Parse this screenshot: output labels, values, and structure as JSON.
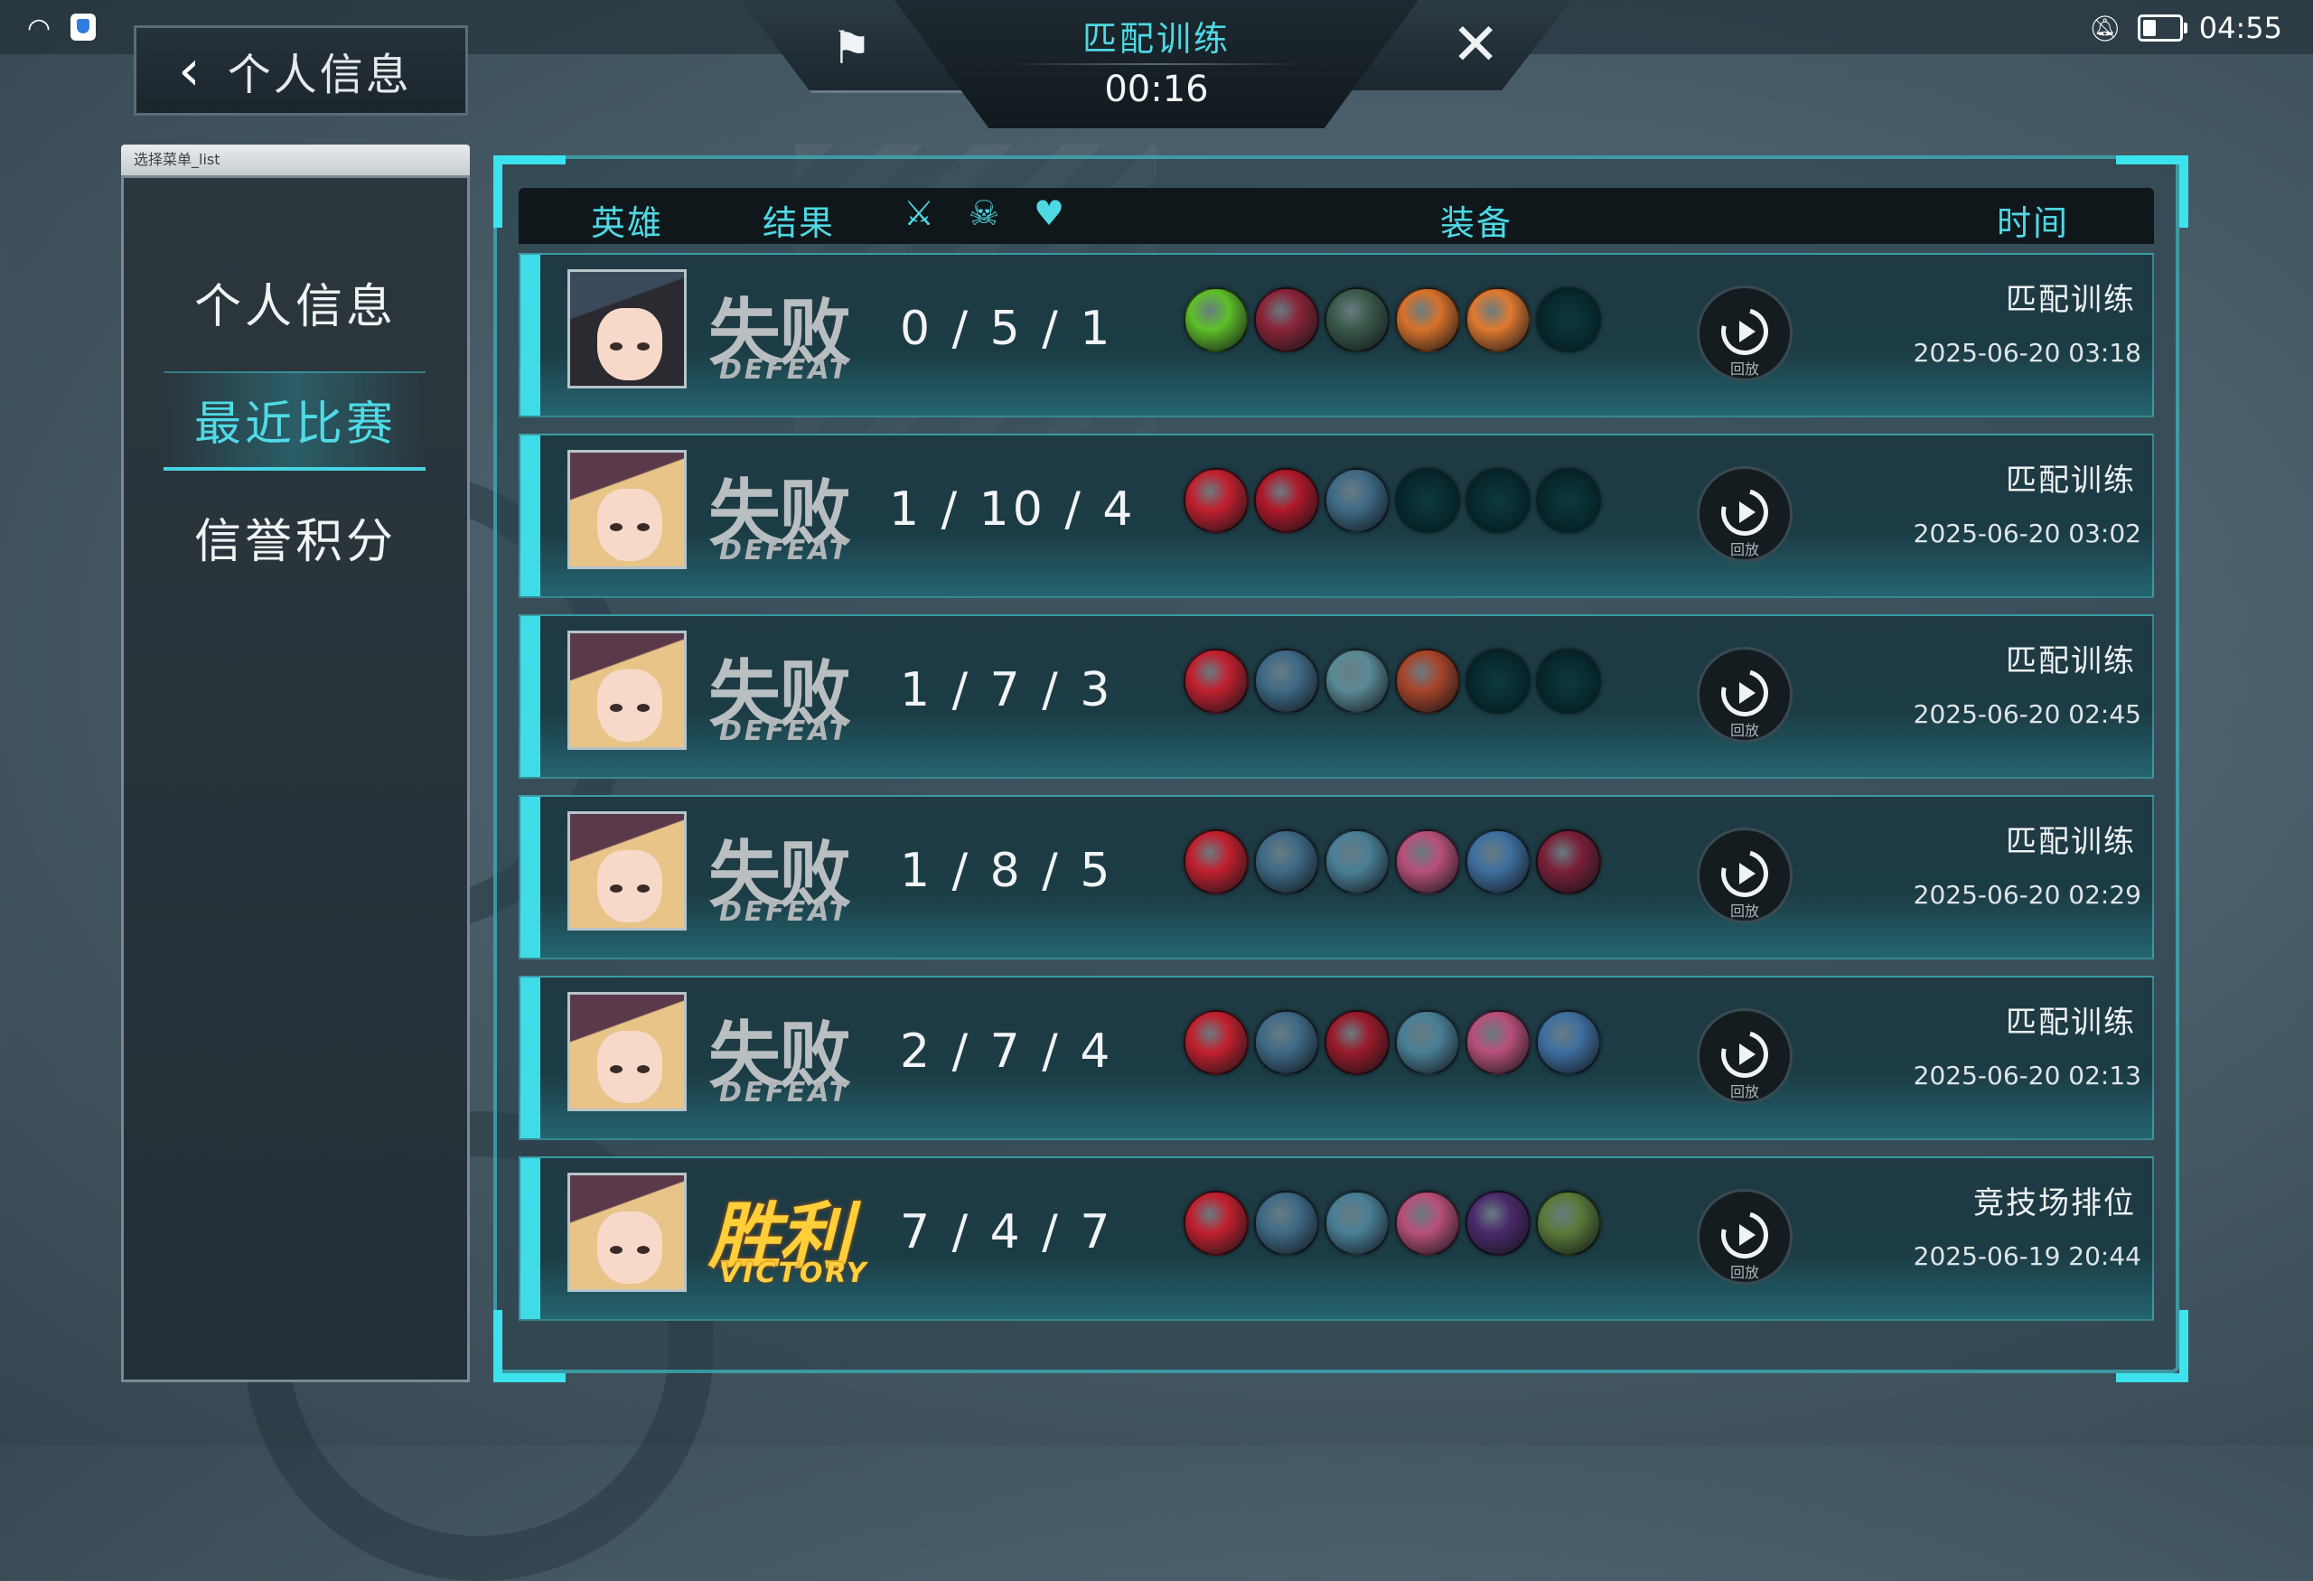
{
  "status_bar": {
    "time": "04:55",
    "wifi_icon": "wifi-icon",
    "mute_icon": "bell-off-icon",
    "battery_icon": "battery-icon"
  },
  "back_button": {
    "label": "个人信息"
  },
  "hud": {
    "mode": "匹配训练",
    "timer": "00:16"
  },
  "menu": {
    "caption": "选择菜单_list",
    "items": [
      {
        "label": "个人信息",
        "active": false
      },
      {
        "label": "最近比赛",
        "active": true
      },
      {
        "label": "信誉积分",
        "active": false
      }
    ]
  },
  "table": {
    "headers": {
      "hero": "英雄",
      "result": "结果",
      "equipment": "装备",
      "time": "时间"
    },
    "header_icons": [
      "sword-icon",
      "skull-icon",
      "handshake-icon"
    ],
    "replay_label": "回放",
    "rows": [
      {
        "hero": "dark-haired-hero",
        "result_zh": "失败",
        "result_en": "DEFEAT",
        "result": "defeat",
        "kda": "0 / 5 / 1",
        "items": [
          "#5fbf2a",
          "#8a2438",
          "#3a5a4a",
          "#d8722a",
          "#e07a30",
          "empty"
        ],
        "mode": "匹配训练",
        "date": "2025-06-20 03:18"
      },
      {
        "hero": "blonde-hero",
        "result_zh": "失败",
        "result_en": "DEFEAT",
        "result": "defeat",
        "kda": "1 / 10 / 4",
        "items": [
          "#c2202e",
          "#b0182a",
          "#3f6a86",
          "empty",
          "empty",
          "empty"
        ],
        "mode": "匹配训练",
        "date": "2025-06-20 03:02"
      },
      {
        "hero": "blonde-hero",
        "result_zh": "失败",
        "result_en": "DEFEAT",
        "result": "defeat",
        "kda": "1 / 7 / 3",
        "items": [
          "#c2202e",
          "#3f6a86",
          "#5a8a96",
          "#a8452a",
          "empty",
          "empty"
        ],
        "mode": "匹配训练",
        "date": "2025-06-20 02:45"
      },
      {
        "hero": "blonde-hero",
        "result_zh": "失败",
        "result_en": "DEFEAT",
        "result": "defeat",
        "kda": "1 / 8 / 5",
        "items": [
          "#c2202e",
          "#3f6a86",
          "#4a7f96",
          "#b8507a",
          "#3f6fa0",
          "#7a2038"
        ],
        "mode": "匹配训练",
        "date": "2025-06-20 02:29"
      },
      {
        "hero": "blonde-hero",
        "result_zh": "失败",
        "result_en": "DEFEAT",
        "result": "defeat",
        "kda": "2 / 7 / 4",
        "items": [
          "#c2202e",
          "#3f6a86",
          "#9a1a2a",
          "#4a7f96",
          "#b8507a",
          "#3f6fa0"
        ],
        "mode": "匹配训练",
        "date": "2025-06-20 02:13"
      },
      {
        "hero": "blonde-hero",
        "result_zh": "胜利",
        "result_en": "VICTORY",
        "result": "victory",
        "kda": "7 / 4 / 7",
        "items": [
          "#c2202e",
          "#3f6a86",
          "#4a7f96",
          "#b8507a",
          "#4a2a6a",
          "#5a7a3a"
        ],
        "mode": "竞技场排位",
        "date": "2025-06-19 20:44"
      }
    ]
  },
  "colors": {
    "accent": "#4fd8e3",
    "defeat": "#b9bec1",
    "victory": "#ffcf3a"
  }
}
